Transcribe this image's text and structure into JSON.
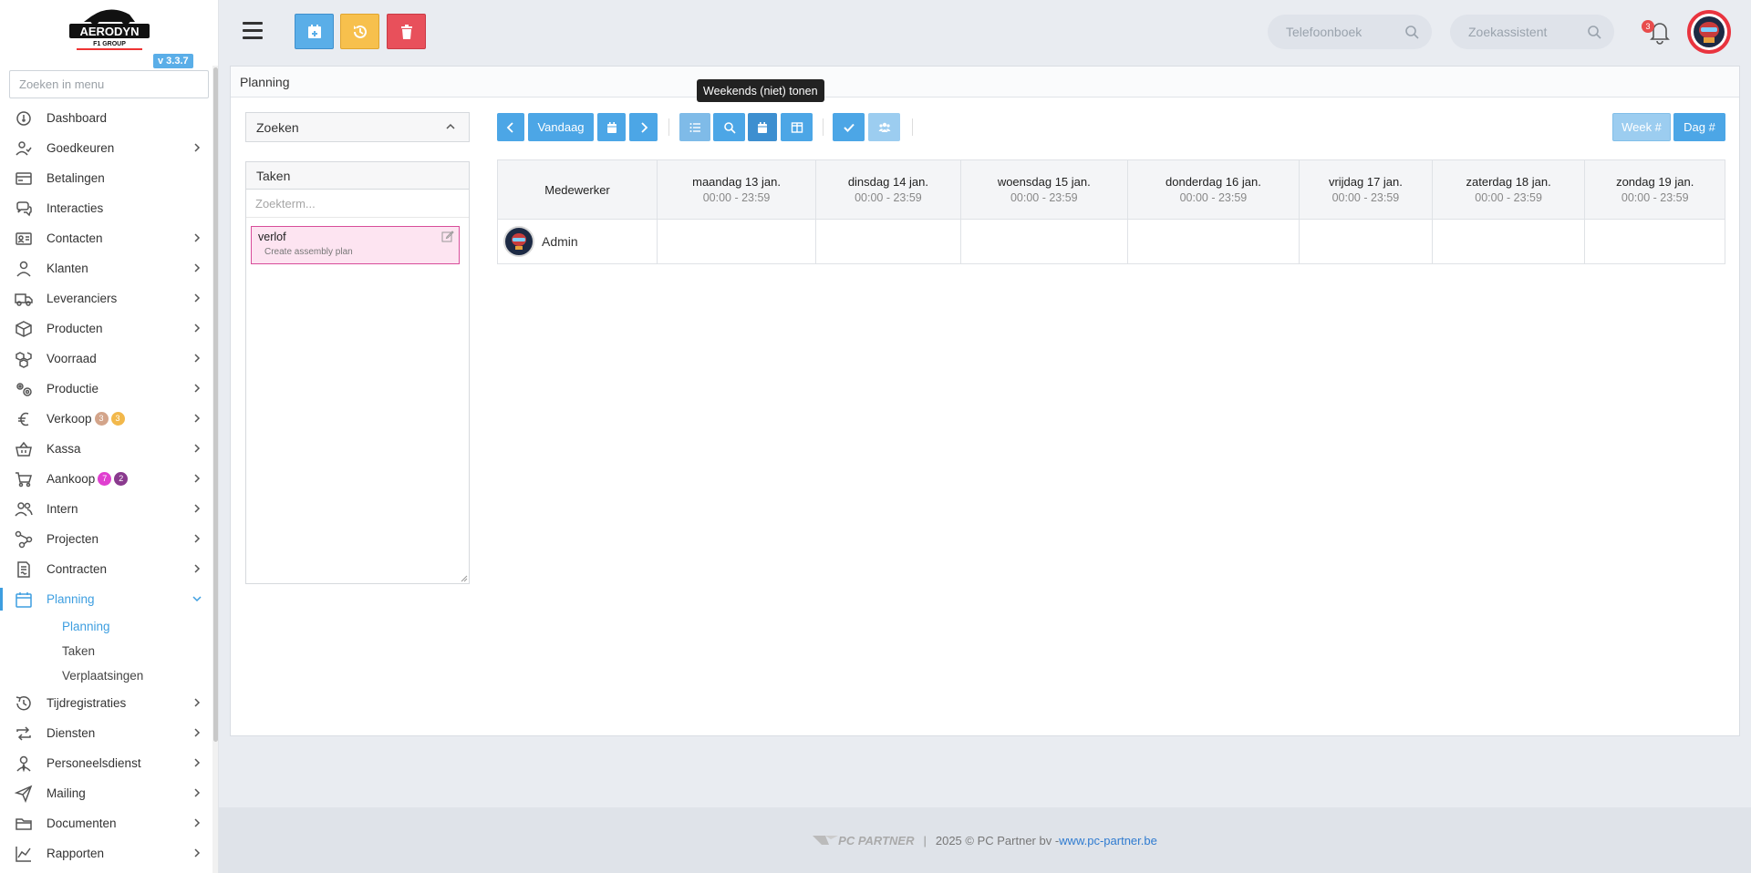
{
  "brand": {
    "name": "AERODYN",
    "tagline": "F1 GROUP",
    "version": "v 3.3.7"
  },
  "menu_search": {
    "placeholder": "Zoeken in menu"
  },
  "menu": [
    {
      "label": "Dashboard",
      "icon": "dashboard-icon",
      "chevron": false
    },
    {
      "label": "Goedkeuren",
      "icon": "user-check-icon",
      "chevron": true
    },
    {
      "label": "Betalingen",
      "icon": "credit-card-icon",
      "chevron": false
    },
    {
      "label": "Interacties",
      "icon": "chat-icon",
      "chevron": false
    },
    {
      "label": "Contacten",
      "icon": "contact-card-icon",
      "chevron": true
    },
    {
      "label": "Klanten",
      "icon": "user-icon",
      "chevron": true
    },
    {
      "label": "Leveranciers",
      "icon": "truck-icon",
      "chevron": true
    },
    {
      "label": "Producten",
      "icon": "box-icon",
      "chevron": true
    },
    {
      "label": "Voorraad",
      "icon": "boxes-icon",
      "chevron": true
    },
    {
      "label": "Productie",
      "icon": "gears-icon",
      "chevron": true
    },
    {
      "label": "Verkoop",
      "icon": "euro-icon",
      "chevron": true,
      "badges": [
        {
          "value": "3",
          "color": "#d3a48a"
        },
        {
          "value": "3",
          "color": "#f2b84b"
        }
      ]
    },
    {
      "label": "Kassa",
      "icon": "basket-icon",
      "chevron": true
    },
    {
      "label": "Aankoop",
      "icon": "cart-icon",
      "chevron": true,
      "badges": [
        {
          "value": "7",
          "color": "#e040d0"
        },
        {
          "value": "2",
          "color": "#8a3a8e"
        }
      ]
    },
    {
      "label": "Intern",
      "icon": "users-icon",
      "chevron": true
    },
    {
      "label": "Projecten",
      "icon": "project-icon",
      "chevron": true
    },
    {
      "label": "Contracten",
      "icon": "contract-icon",
      "chevron": true
    },
    {
      "label": "Planning",
      "icon": "calendar-icon",
      "chevron": true,
      "active": true,
      "expanded": true,
      "children": [
        {
          "label": "Planning",
          "active": true
        },
        {
          "label": "Taken"
        },
        {
          "label": "Verplaatsingen"
        }
      ]
    },
    {
      "label": "Tijdregistraties",
      "icon": "clock-icon",
      "chevron": true
    },
    {
      "label": "Diensten",
      "icon": "repeat-icon",
      "chevron": true
    },
    {
      "label": "Personeelsdienst",
      "icon": "person-tie-icon",
      "chevron": true
    },
    {
      "label": "Mailing",
      "icon": "paper-plane-icon",
      "chevron": true
    },
    {
      "label": "Documenten",
      "icon": "folder-icon",
      "chevron": true
    },
    {
      "label": "Rapporten",
      "icon": "chart-line-icon",
      "chevron": true
    }
  ],
  "topbar": {
    "phonebook_placeholder": "Telefoonboek",
    "assistant_placeholder": "Zoekassistent",
    "notifications_count": "3"
  },
  "page": {
    "title": "Planning"
  },
  "filters": {
    "search_title": "Zoeken"
  },
  "tasks": {
    "title": "Taken",
    "search_placeholder": "Zoekterm...",
    "items": [
      {
        "title": "verlof",
        "subtitle": "Create assembly plan"
      }
    ]
  },
  "toolbar": {
    "today_label": "Vandaag",
    "week_label": "Week #",
    "day_label": "Dag #",
    "tooltip": "Weekends (niet) tonen"
  },
  "grid": {
    "employee_header": "Medewerker",
    "days": [
      {
        "label": "maandag 13 jan.",
        "hours": "00:00 - 23:59"
      },
      {
        "label": "dinsdag 14 jan.",
        "hours": "00:00 - 23:59"
      },
      {
        "label": "woensdag 15 jan.",
        "hours": "00:00 - 23:59"
      },
      {
        "label": "donderdag 16 jan.",
        "hours": "00:00 - 23:59"
      },
      {
        "label": "vrijdag 17 jan.",
        "hours": "00:00 - 23:59"
      },
      {
        "label": "zaterdag 18 jan.",
        "hours": "00:00 - 23:59"
      },
      {
        "label": "zondag 19 jan.",
        "hours": "00:00 - 23:59"
      }
    ],
    "employees": [
      {
        "name": "Admin"
      }
    ]
  },
  "footer": {
    "logo_text": "PC PARTNER",
    "copyright": "2025 © PC Partner bv - ",
    "link": "www.pc-partner.be"
  },
  "colors": {
    "primary": "#4ca6e6",
    "warning": "#f7c04d",
    "danger": "#e8505b",
    "active": "#3d9ee0"
  }
}
